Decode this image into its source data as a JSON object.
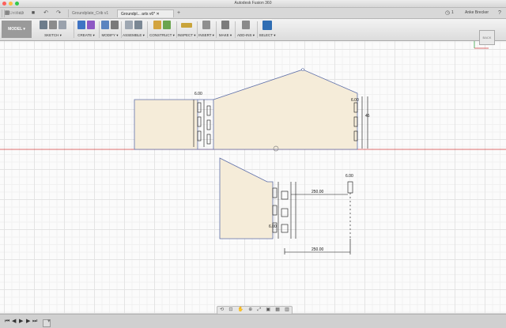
{
  "app_title": "Autodesk Fusion 360",
  "tabs": [
    {
      "label": "Untitled"
    },
    {
      "label": "Groundplate_Crib v1"
    },
    {
      "label": "Groundpl... arts v6*"
    }
  ],
  "user": {
    "name": "Anke Brecker",
    "count": "1"
  },
  "ribbon": {
    "mode": "MODEL",
    "groups": [
      {
        "label": "SKETCH"
      },
      {
        "label": "CREATE"
      },
      {
        "label": "MODIFY"
      },
      {
        "label": "ASSEMBLE"
      },
      {
        "label": "CONSTRUCT"
      },
      {
        "label": "INSPECT"
      },
      {
        "label": "INSERT"
      },
      {
        "label": "MAKE"
      },
      {
        "label": "ADD-INS"
      },
      {
        "label": "SELECT"
      }
    ]
  },
  "viewcube": {
    "label": "BACK"
  },
  "dimensions": {
    "tab_width_top": "6.00",
    "tab_width_right": "6.00",
    "tab_width_part2": "6.00",
    "tab_width_part2_b": "6.00",
    "span_upper": "250.00",
    "span_lower": "250.00",
    "tab_depth_label": "45"
  },
  "colors": {
    "accent": "#2f6db3",
    "sketch_fill": "#f5ecd9",
    "sketch_line": "#5d6ea8",
    "dim_color": "#111111",
    "axis_red": "#d23c3c",
    "axis_green": "#3aa34a"
  }
}
